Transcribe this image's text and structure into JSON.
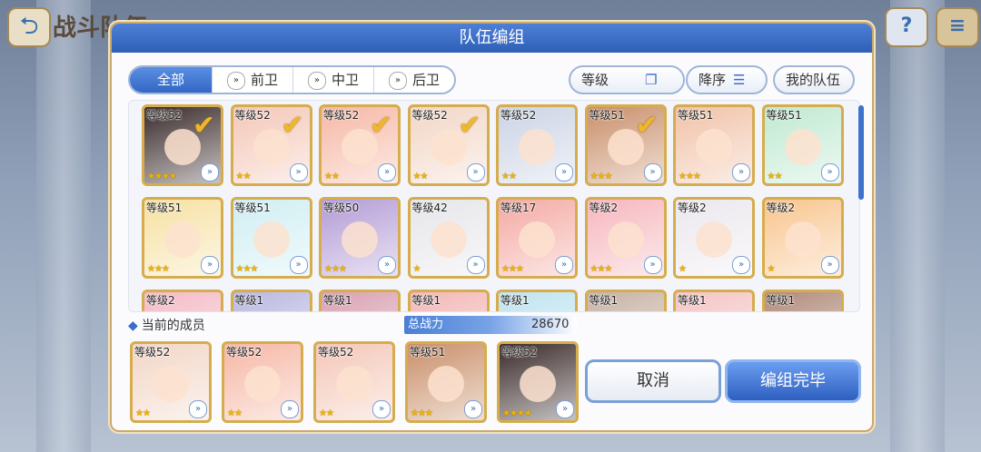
{
  "background": {
    "title": "战斗队伍"
  },
  "dialog": {
    "title": "队伍编组"
  },
  "filters": {
    "tabs": [
      {
        "label": "全部",
        "active": true
      },
      {
        "label": "前卫",
        "active": false
      },
      {
        "label": "中卫",
        "active": false
      },
      {
        "label": "后卫",
        "active": false
      }
    ],
    "sort_label": "等级",
    "order_label": "降序",
    "my_team_label": "我的队伍"
  },
  "roster": [
    {
      "level": "等级52",
      "stars": "★★★★",
      "selected": true,
      "color": "#3a2a2a"
    },
    {
      "level": "等级52",
      "stars": "★★",
      "selected": true,
      "color": "#f4c7b8"
    },
    {
      "level": "等级52",
      "stars": "★★",
      "selected": true,
      "color": "#f6b7a5"
    },
    {
      "level": "等级52",
      "stars": "★★",
      "selected": true,
      "color": "#f2d6c6"
    },
    {
      "level": "等级52",
      "stars": "★★",
      "selected": false,
      "color": "#cbd3e5"
    },
    {
      "level": "等级51",
      "stars": "★★★",
      "selected": true,
      "color": "#c98f6a"
    },
    {
      "level": "等级51",
      "stars": "★★★",
      "selected": false,
      "color": "#f1c2a8"
    },
    {
      "level": "等级51",
      "stars": "★★",
      "selected": false,
      "color": "#bfe9d1"
    },
    {
      "level": "等级51",
      "stars": "★★★",
      "selected": false,
      "color": "#f6e1a2"
    },
    {
      "level": "等级51",
      "stars": "★★★",
      "selected": false,
      "color": "#cfeef2"
    },
    {
      "level": "等级50",
      "stars": "★★★",
      "selected": false,
      "color": "#b39bd6"
    },
    {
      "level": "等级42",
      "stars": "★",
      "selected": false,
      "color": "#e6e6ea"
    },
    {
      "level": "等级17",
      "stars": "★★★",
      "selected": false,
      "color": "#f4a9a3"
    },
    {
      "level": "等级2",
      "stars": "★★★",
      "selected": false,
      "color": "#f6b6bd"
    },
    {
      "level": "等级2",
      "stars": "★",
      "selected": false,
      "color": "#ece8ee"
    },
    {
      "level": "等级2",
      "stars": "★",
      "selected": false,
      "color": "#f8c58e"
    },
    {
      "level": "等级2",
      "stars": "",
      "selected": false,
      "color": "#f4bac6"
    },
    {
      "level": "等级1",
      "stars": "",
      "selected": false,
      "color": "#b9b7e0"
    },
    {
      "level": "等级1",
      "stars": "",
      "selected": false,
      "color": "#d9a0b2"
    },
    {
      "level": "等级1",
      "stars": "",
      "selected": false,
      "color": "#f3b6b6"
    },
    {
      "level": "等级1",
      "stars": "",
      "selected": false,
      "color": "#bfe3ef"
    },
    {
      "level": "等级1",
      "stars": "",
      "selected": false,
      "color": "#c7b2a4"
    },
    {
      "level": "等级1",
      "stars": "",
      "selected": false,
      "color": "#f4c4c4"
    },
    {
      "level": "等级1",
      "stars": "",
      "selected": false,
      "color": "#b08a7a"
    }
  ],
  "current_team": {
    "label": "当前的成员",
    "power_label": "总战力",
    "power_value": "28670",
    "members": [
      {
        "level": "等级52",
        "stars": "★★",
        "color": "#f2d6c6"
      },
      {
        "level": "等级52",
        "stars": "★★",
        "color": "#f6b7a5"
      },
      {
        "level": "等级52",
        "stars": "★★",
        "color": "#f4c7b8"
      },
      {
        "level": "等级51",
        "stars": "★★★",
        "color": "#c98f6a"
      },
      {
        "level": "等级52",
        "stars": "★★★★",
        "color": "#3a2a2a"
      }
    ]
  },
  "buttons": {
    "cancel": "取消",
    "confirm": "编组完毕"
  }
}
